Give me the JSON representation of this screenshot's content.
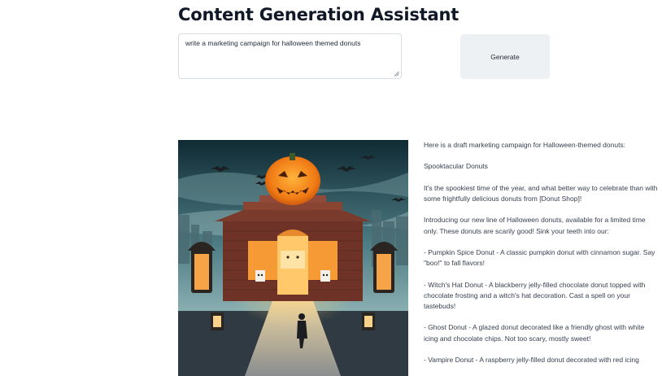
{
  "page": {
    "title": "Content Generation Assistant"
  },
  "prompt": {
    "value": "write a marketing campaign for halloween themed donuts"
  },
  "generate_button": {
    "label": "Generate"
  },
  "result": {
    "image_description": "Illustration of a Halloween donut shop with a giant jack-o'-lantern on the roof",
    "paragraphs": [
      "Here is a draft marketing campaign for Halloween-themed donuts:",
      "Spooktacular Donuts",
      "It's the spookiest time of the year, and what better way to celebrate than with some frightfully delicious donuts from [Donut Shop]!",
      "Introducing our new line of Halloween donuts, available for a limited time only. These donuts are scarily good! Sink your teeth into our:",
      "- Pumpkin Spice Donut - A classic pumpkin donut with cinnamon sugar. Say \"boo!\" to fall flavors!",
      "- Witch's Hat Donut - A blackberry jelly-filled chocolate donut topped with chocolate frosting and a witch's hat decoration. Cast a spell on your tastebuds!",
      "- Ghost Donut - A glazed donut decorated like a friendly ghost with white icing and chocolate chips. Not too scary, mostly sweet!",
      "- Vampire Donut - A raspberry jelly-filled donut decorated with red icing"
    ]
  }
}
